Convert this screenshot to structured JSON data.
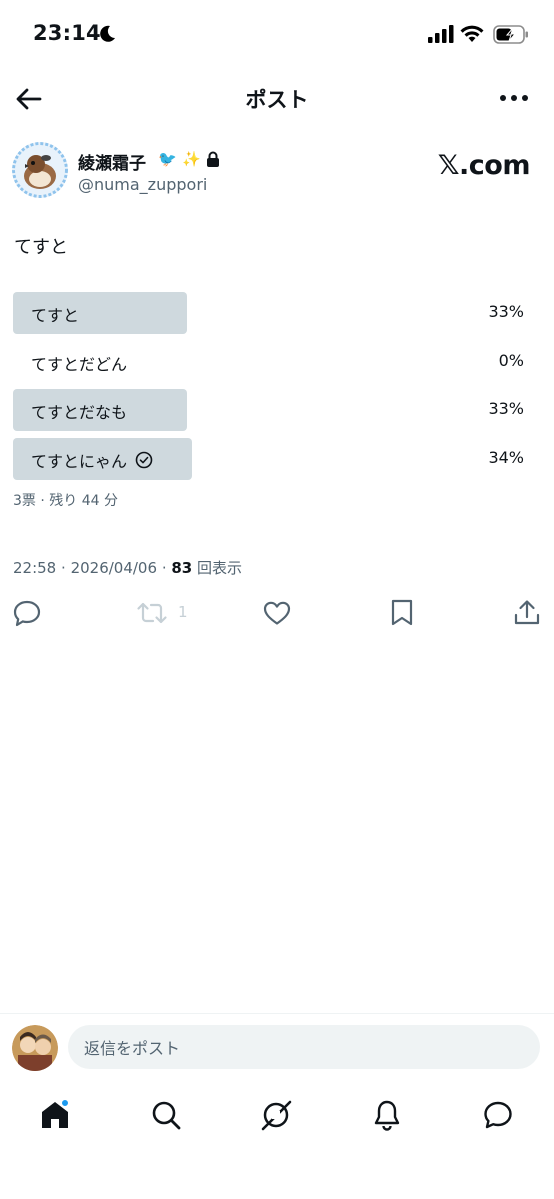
{
  "status": {
    "time": "23:14"
  },
  "nav": {
    "title": "ポスト"
  },
  "author": {
    "display_name": "綾瀬霜子",
    "emoji1": "🐦",
    "emoji2": "✨",
    "handle": "@numa_zuppori",
    "logo": "𝕏.com"
  },
  "post": {
    "text": "てすと"
  },
  "poll": {
    "options": [
      {
        "label": "てすと",
        "percent": "33%",
        "value": 33,
        "voted": false
      },
      {
        "label": "てすとだどん",
        "percent": "0%",
        "value": 0,
        "voted": false
      },
      {
        "label": "てすとだなも",
        "percent": "33%",
        "value": 33,
        "voted": false
      },
      {
        "label": "てすとにゃん",
        "percent": "34%",
        "value": 34,
        "voted": true
      }
    ],
    "meta": "3票 · 残り 44 分"
  },
  "meta": {
    "time": "22:58",
    "date": "2026/04/06",
    "views": "83",
    "views_label": "回表示"
  },
  "actions": {
    "retweet_count": "1"
  },
  "reply": {
    "placeholder": "返信をポスト"
  },
  "colors": {
    "accent": "#1d9bf0",
    "poll_bar": "#cfd9de",
    "muted": "#536471"
  }
}
